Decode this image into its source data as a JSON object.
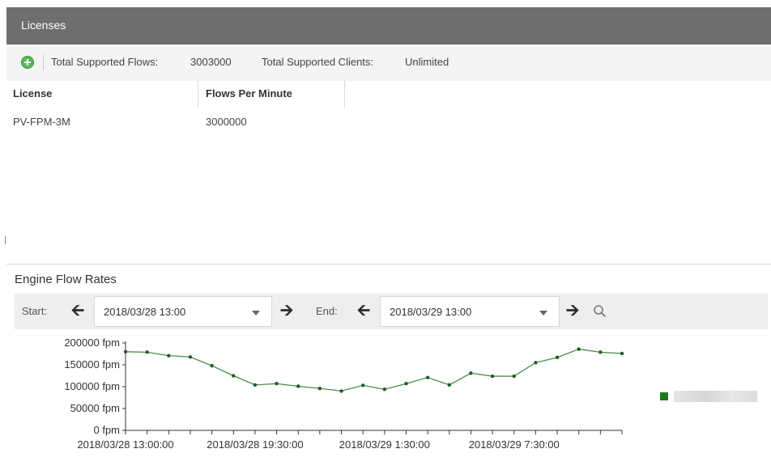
{
  "header": {
    "title": "Licenses"
  },
  "summary": {
    "flows_label": "Total Supported Flows:",
    "flows_value": "3003000",
    "clients_label": "Total Supported Clients:",
    "clients_value": "Unlimited",
    "add_icon": "plus-circle-icon"
  },
  "licenses_table": {
    "columns": [
      "License",
      "Flows Per Minute"
    ],
    "rows": [
      {
        "license": "PV-FPM-3M",
        "flows_per_minute": "3000000"
      }
    ]
  },
  "flow_rates": {
    "title": "Engine Flow Rates",
    "start_label": "Start:",
    "start_value": "2018/03/28 13:00",
    "end_label": "End:",
    "end_value": "2018/03/29 13:00",
    "back_icon": "arrow-left-icon",
    "forward_icon": "arrow-right-icon",
    "search_icon": "search-icon"
  },
  "colors": {
    "series": "#4c8a4c",
    "marker": "#1f5f1f",
    "header_bg": "#6e6e6e"
  },
  "chart_data": {
    "type": "line",
    "y_ticks": [
      "200000 fpm",
      "150000 fpm",
      "100000 fpm",
      "50000 fpm",
      "0 fpm"
    ],
    "ylim": [
      0,
      200000
    ],
    "x_tick_labels": [
      "2018/03/28 13:00:00",
      "2018/03/28 19:30:00",
      "2018/03/29 1:30:00",
      "2018/03/29 7:30:00"
    ],
    "x_tick_label_indices": [
      0,
      6,
      12,
      18
    ],
    "x_minor_tick_count": 24,
    "series": [
      {
        "values": [
          180000,
          179000,
          171000,
          168000,
          148000,
          125000,
          104000,
          107000,
          101000,
          96000,
          90000,
          103000,
          94000,
          107000,
          121000,
          104000,
          131000,
          124000,
          124000,
          155000,
          167000,
          186000,
          179000,
          176000
        ]
      }
    ],
    "legend_placement": "right",
    "grid": false
  }
}
